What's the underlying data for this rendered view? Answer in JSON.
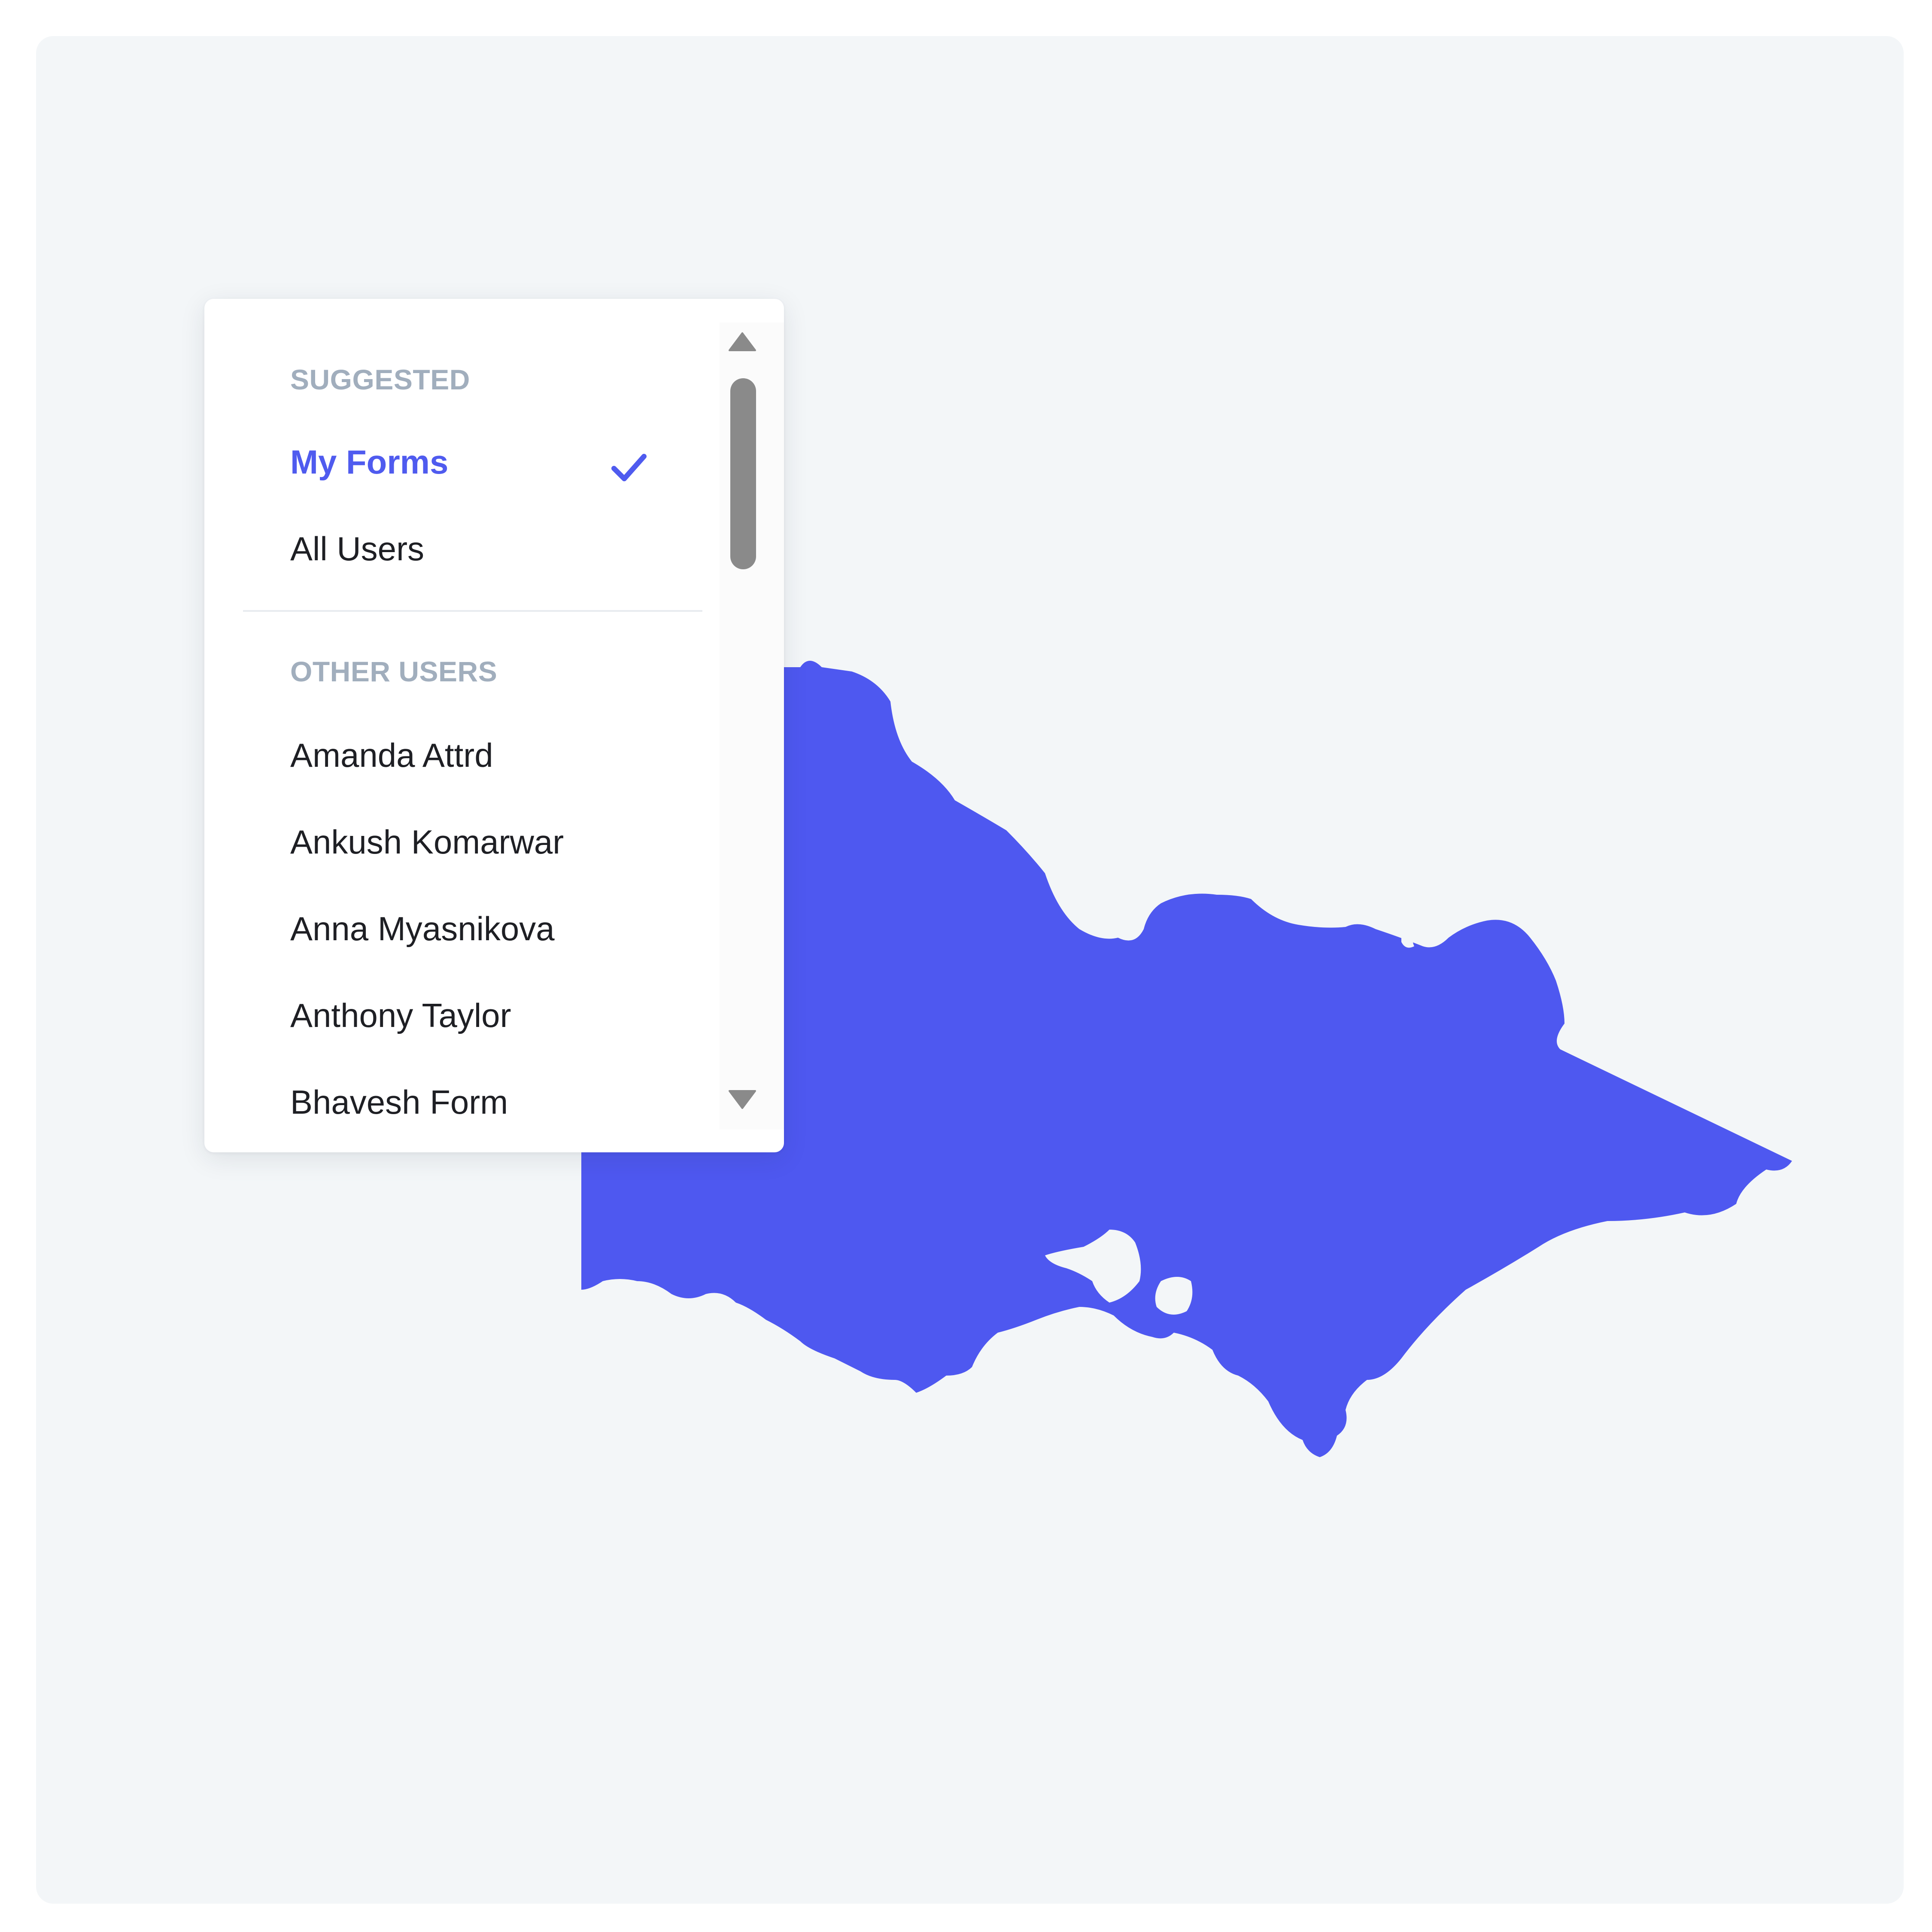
{
  "colors": {
    "map_fill": "#4e58f0",
    "accent": "#4f5bef",
    "background": "#f3f6f8"
  },
  "dropdown": {
    "suggested_header": "SUGGESTED",
    "suggested_items": [
      {
        "label": "My Forms",
        "selected": true
      },
      {
        "label": "All Users",
        "selected": false
      }
    ],
    "other_header": "OTHER USERS",
    "other_items": [
      {
        "label": "Amanda Attrd"
      },
      {
        "label": "Ankush Komarwar"
      },
      {
        "label": "Anna Myasnikova"
      },
      {
        "label": "Anthony Taylor"
      },
      {
        "label": "Bhavesh Form"
      }
    ],
    "icons": {
      "check": "check-icon",
      "scroll_up": "scroll-up-arrow-icon",
      "scroll_down": "scroll-down-arrow-icon"
    }
  }
}
